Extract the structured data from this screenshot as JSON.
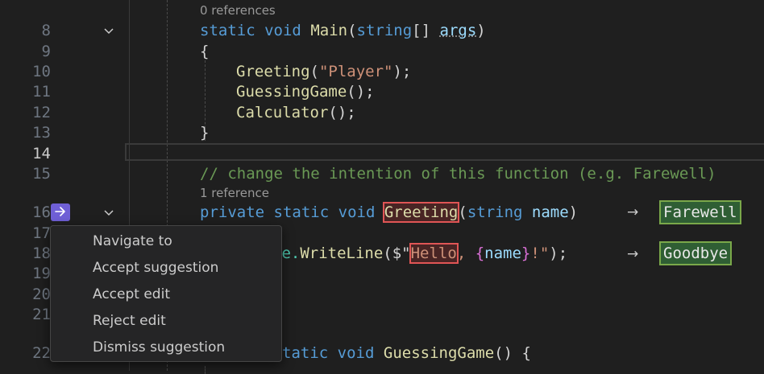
{
  "line_numbers": [
    "8",
    "9",
    "10",
    "11",
    "12",
    "13",
    "14",
    "15",
    "16",
    "17",
    "18",
    "19",
    "20",
    "21",
    "22"
  ],
  "codelens": {
    "main_refs": "0 references",
    "greeting_refs": "1 reference"
  },
  "code": {
    "l8": {
      "kw1": "static",
      "kw2": "void",
      "fn": "Main",
      "p1": "(",
      "type": "string",
      "p2": "[] ",
      "param": "args",
      "p3": ")"
    },
    "l9": "{",
    "l10": {
      "fn": "Greeting",
      "p1": "(",
      "str": "\"Player\"",
      "p2": ");"
    },
    "l11": {
      "fn": "GuessingGame",
      "p1": "();"
    },
    "l12": {
      "fn": "Calculator",
      "p1": "();"
    },
    "l13": "}",
    "l15": "// change the intention of this function (e.g. Farewell)",
    "l16": {
      "kw1": "private",
      "kw2": "static",
      "kw3": "void",
      "fn": "Greeting",
      "p1": "(",
      "type": "string",
      "param": "name",
      "p2": ")"
    },
    "l18": {
      "prefix": "le.",
      "fn": "WriteLine",
      "p1": "($\"",
      "str_hl": "Hello",
      "str_rest": ", ",
      "brace_open": "{",
      "param": "name",
      "brace_close": "}",
      "str_end": "!\"",
      "p2": ");"
    },
    "l22": {
      "kw1": "tatic",
      "kw2": "void",
      "fn": "GuessingGame",
      "p1": "() {"
    }
  },
  "suggestions": {
    "greeting_replacement": "Farewell",
    "hello_replacement": "Goodbye",
    "arrow": "→"
  },
  "context_menu": {
    "items": [
      "Navigate to",
      "Accept suggestion",
      "Accept edit",
      "Reject edit",
      "Dismiss suggestion"
    ]
  },
  "icons": {
    "fold": "chevron-down-icon",
    "nes": "arrow-right-icon"
  },
  "colors": {
    "background": "#1f1f1f",
    "keyword": "#569cd6",
    "function": "#dcdcaa",
    "string": "#ce9178",
    "parameter": "#9cdcfe",
    "comment": "#6a9955",
    "suggestion_badge": "#6f5fd6",
    "old_highlight": "#e05555",
    "new_highlight": "#2f5e34"
  }
}
